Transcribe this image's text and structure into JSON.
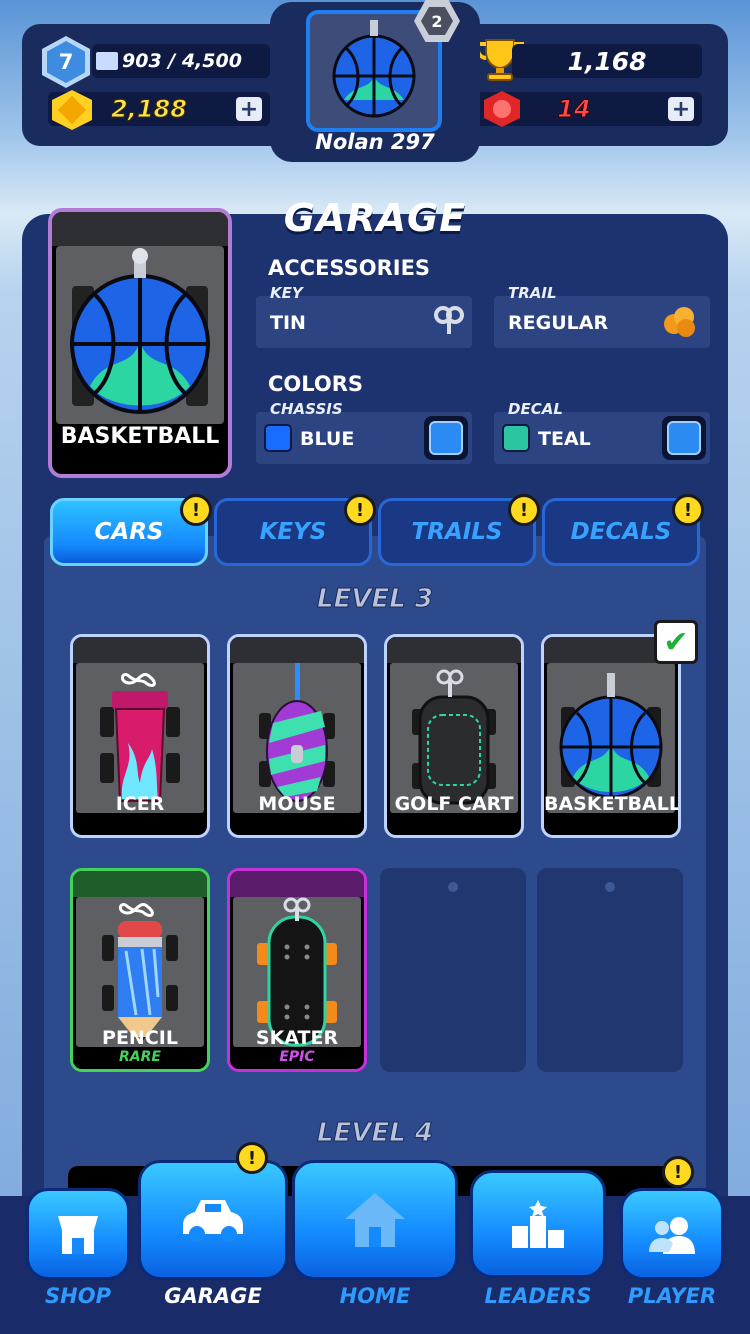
{
  "header": {
    "level": "7",
    "xp": "903 / 4,500",
    "coins": "2,188",
    "trophies": "1,168",
    "gems": "14",
    "player_name": "Nolan 297",
    "rank": "2"
  },
  "garage": {
    "title": "GARAGE",
    "selected_car": "BASKETBALL",
    "accessories_heading": "ACCESSORIES",
    "key_caption": "KEY",
    "key_value": "TIN",
    "trail_caption": "TRAIL",
    "trail_value": "REGULAR",
    "colors_heading": "COLORS",
    "chassis_caption": "CHASSIS",
    "chassis_value": "BLUE",
    "chassis_color": "#1a6cff",
    "decal_caption": "DECAL",
    "decal_value": "TEAL",
    "decal_color": "#2cc5a2"
  },
  "tabs": [
    {
      "label": "CARS",
      "active": true
    },
    {
      "label": "KEYS",
      "active": false
    },
    {
      "label": "TRAILS",
      "active": false
    },
    {
      "label": "DECALS",
      "active": false
    }
  ],
  "level3_heading": "LEVEL 3",
  "level4_heading": "LEVEL 4",
  "cars": [
    {
      "name": "ICER"
    },
    {
      "name": "MOUSE"
    },
    {
      "name": "GOLF CART"
    },
    {
      "name": "BASKETBALL"
    },
    {
      "name": "PENCIL",
      "rarity": "RARE"
    },
    {
      "name": "SKATER",
      "rarity": "EPIC"
    }
  ],
  "nav": {
    "shop": "SHOP",
    "garage": "GARAGE",
    "home": "HOME",
    "leaders": "LEADERS",
    "player": "PLAYER"
  },
  "notification_mark": "!",
  "check_mark": "✔"
}
